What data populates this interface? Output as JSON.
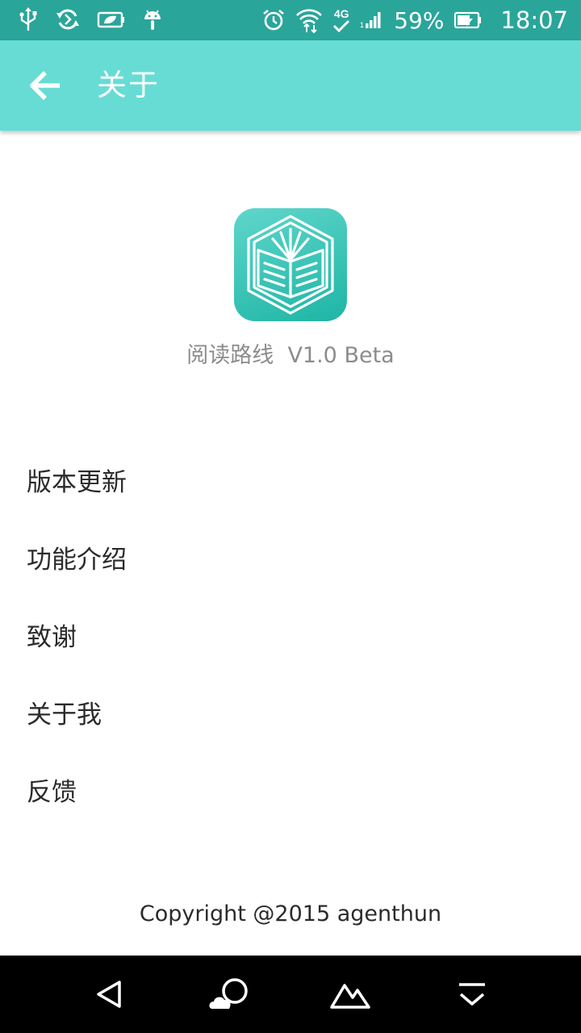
{
  "status_bar": {
    "battery_percent": "59%",
    "time": "18:07",
    "network_label": "4G",
    "icons": [
      "usb-icon",
      "sync-icon",
      "battery-saver-icon",
      "android-icon",
      "alarm-icon",
      "wifi-icon",
      "network-4g-icon",
      "signal-icon",
      "battery-charging-icon"
    ]
  },
  "app_bar": {
    "title": "关于",
    "back_icon": "arrow-back-icon",
    "color": "#67dcd4"
  },
  "app_info": {
    "name_version": "阅读路线  V1.0 Beta",
    "logo_icon": "open-book-hexagon-icon"
  },
  "menu": [
    {
      "label": "版本更新"
    },
    {
      "label": "功能介绍"
    },
    {
      "label": "致谢"
    },
    {
      "label": "关于我"
    },
    {
      "label": "反馈"
    }
  ],
  "footer": {
    "copyright": "Copyright @2015 agenthun"
  },
  "nav_bar": {
    "buttons": [
      "back-triangle-icon",
      "home-cloud-icon",
      "recents-mountain-icon",
      "dropdown-chevron-icon"
    ]
  },
  "colors": {
    "status_bar": "#2aa59a",
    "accent": "#67dcd4",
    "logo_gradient_top": "#5fd6cb",
    "logo_gradient_bottom": "#1eb5a5"
  }
}
